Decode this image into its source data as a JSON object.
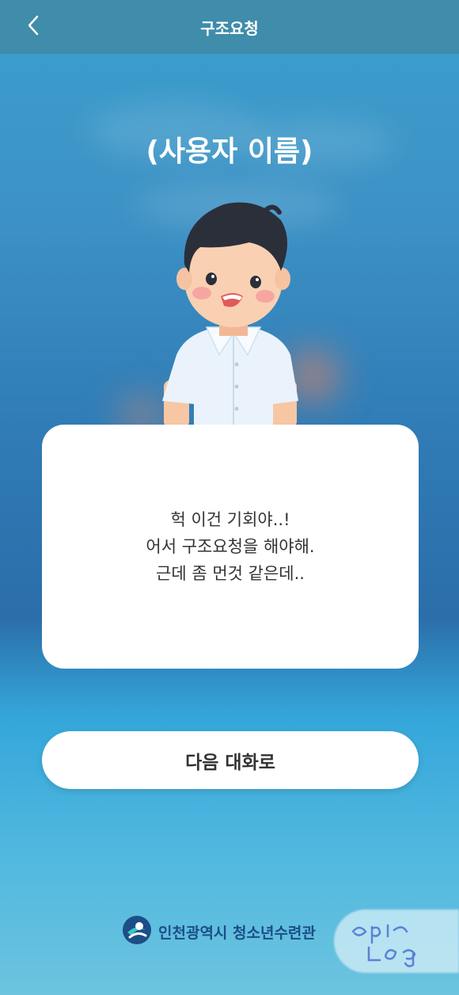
{
  "header": {
    "title": "구조요청",
    "back_icon": "chevron-left-icon"
  },
  "user_name": "(사용자 이름)",
  "dialog": {
    "lines": [
      "헉 이건 기회야..!",
      "어서 구조요청을 해야해.",
      "근데 좀 먼것 같은데.."
    ]
  },
  "next_button": {
    "label": "다음 대화로"
  },
  "footer": {
    "org_name": "인천광역시 청소년수련관",
    "logo_icon": "org-logo-icon"
  },
  "watermark": {
    "text": "epic log"
  },
  "colors": {
    "header_bg": "#3f8cab",
    "footer_text": "#1c4e87",
    "text_dark": "#333333"
  }
}
